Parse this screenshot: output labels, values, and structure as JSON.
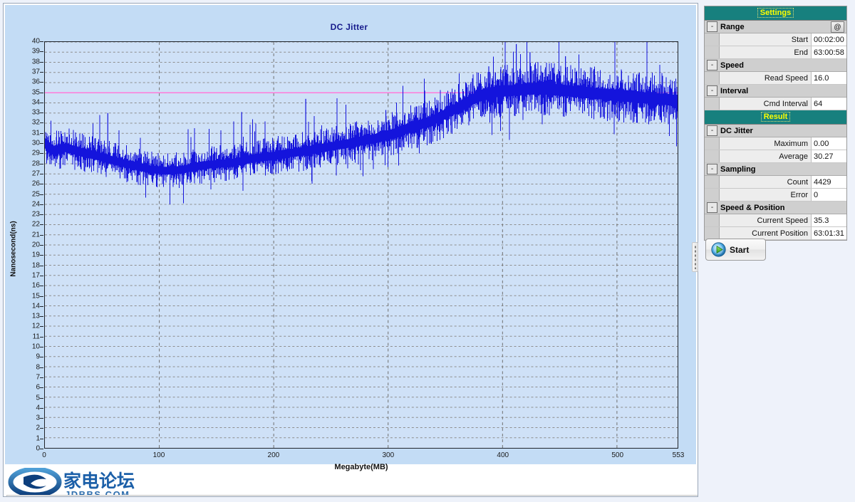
{
  "chart_panel": {
    "title": "DC Jitter",
    "xtitle": "Megabyte(MB)",
    "ytitle": "Nanosecond(ns)",
    "watermark": {
      "cn": "家电论坛",
      "en": "JDBBS.COM"
    }
  },
  "colors": {
    "series": "#1414dc",
    "reference_line": "#ff7ad9",
    "plot_bg": "#cfe1f7",
    "panel_sky": "#c3dcf5",
    "header_bg": "#17807e",
    "header_text": "#ffff00",
    "title_text": "#161b8c"
  },
  "settings": {
    "header": "Settings",
    "at_button": "@",
    "groups": [
      {
        "name": "Range",
        "collapse": "-",
        "rows": [
          {
            "label": "Start",
            "value": "00:02:00"
          },
          {
            "label": "End",
            "value": "63:00:58"
          }
        ]
      },
      {
        "name": "Speed",
        "collapse": "-",
        "rows": [
          {
            "label": "Read Speed",
            "value": "16.0"
          }
        ]
      },
      {
        "name": "Interval",
        "collapse": "-",
        "rows": [
          {
            "label": "Cmd Interval",
            "value": "64"
          }
        ]
      }
    ]
  },
  "result": {
    "header": "Result",
    "groups": [
      {
        "name": "DC Jitter",
        "collapse": "-",
        "rows": [
          {
            "label": "Maximum",
            "value": "0.00"
          },
          {
            "label": "Average",
            "value": "30.27"
          }
        ]
      },
      {
        "name": "Sampling",
        "collapse": "-",
        "rows": [
          {
            "label": "Count",
            "value": "4429"
          },
          {
            "label": "Error",
            "value": "0"
          }
        ]
      },
      {
        "name": "Speed & Position",
        "collapse": "-",
        "rows": [
          {
            "label": "Current Speed",
            "value": "35.3"
          },
          {
            "label": "Current Position",
            "value": "63:01:31"
          }
        ]
      }
    ]
  },
  "start_button": {
    "label": "Start",
    "icon": "play-icon"
  },
  "chart_data": {
    "type": "line",
    "title": "DC Jitter",
    "xlabel": "Megabyte(MB)",
    "ylabel": "Nanosecond(ns)",
    "xlim": [
      0,
      553
    ],
    "ylim": [
      0,
      40
    ],
    "xticks": [
      0,
      100,
      200,
      300,
      400,
      500,
      553
    ],
    "yticks": [
      0,
      1,
      2,
      3,
      4,
      5,
      6,
      7,
      8,
      9,
      10,
      11,
      12,
      13,
      14,
      15,
      16,
      17,
      18,
      19,
      20,
      21,
      22,
      23,
      24,
      25,
      26,
      27,
      28,
      29,
      30,
      31,
      32,
      33,
      34,
      35,
      36,
      37,
      38,
      39,
      40
    ],
    "grid": true,
    "legend": "none",
    "reference_lines": [
      {
        "y": 35,
        "color": "#ff7ad9"
      }
    ],
    "annotations": {
      "average": 30.27,
      "sample_count": 4429,
      "errors": 0
    },
    "series": [
      {
        "name": "DC Jitter",
        "color": "#1414dc",
        "description": "Dense noisy jitter trace sampled across the disc; envelope given as min/max band per MB control point.",
        "x": [
          0,
          8,
          18,
          30,
          45,
          60,
          75,
          90,
          105,
          120,
          135,
          150,
          165,
          172,
          180,
          195,
          210,
          225,
          240,
          255,
          270,
          285,
          300,
          310,
          320,
          335,
          345,
          355,
          365,
          375,
          385,
          395,
          405,
          415,
          425,
          435,
          445,
          455,
          465,
          475,
          485,
          495,
          505,
          515,
          525,
          535,
          545,
          553
        ],
        "center": [
          30.0,
          29.3,
          29.6,
          29.2,
          28.8,
          28.3,
          27.9,
          27.5,
          27.3,
          27.4,
          27.8,
          28.0,
          28.1,
          28.3,
          28.5,
          28.7,
          29.0,
          29.2,
          29.5,
          29.8,
          30.1,
          30.4,
          30.8,
          31.2,
          31.6,
          32.1,
          32.6,
          33.2,
          33.8,
          34.4,
          34.9,
          35.1,
          35.2,
          35.3,
          35.4,
          35.4,
          35.3,
          35.2,
          35.1,
          35.0,
          34.9,
          34.8,
          34.7,
          34.6,
          34.5,
          34.4,
          34.3,
          34.2
        ],
        "min": [
          28.6,
          27.8,
          28.0,
          27.6,
          27.2,
          26.7,
          26.3,
          26.0,
          25.9,
          26.0,
          26.4,
          26.6,
          26.7,
          27.0,
          27.1,
          27.3,
          27.5,
          27.7,
          28.0,
          28.3,
          28.6,
          28.9,
          29.2,
          29.6,
          30.0,
          30.4,
          30.9,
          31.4,
          32.0,
          32.5,
          32.9,
          33.1,
          33.2,
          33.3,
          33.3,
          33.3,
          33.2,
          33.1,
          33.0,
          32.9,
          32.8,
          32.6,
          32.5,
          32.4,
          32.3,
          32.2,
          32.1,
          32.0
        ],
        "max": [
          31.8,
          31.2,
          31.4,
          30.9,
          30.4,
          29.8,
          29.3,
          29.0,
          28.8,
          29.0,
          29.4,
          29.6,
          29.8,
          30.0,
          30.2,
          30.4,
          30.7,
          31.0,
          31.3,
          31.6,
          32.0,
          32.4,
          32.8,
          33.2,
          33.7,
          34.2,
          34.8,
          35.4,
          36.0,
          36.6,
          37.1,
          37.4,
          37.5,
          37.6,
          37.7,
          37.7,
          37.6,
          37.5,
          37.4,
          37.3,
          37.2,
          37.0,
          36.9,
          36.8,
          36.7,
          36.6,
          36.5,
          36.4
        ],
        "spikes": [
          {
            "x": 55,
            "y": 33.0
          },
          {
            "x": 172,
            "y": 33.1
          },
          {
            "x": 228,
            "y": 34.4
          },
          {
            "x": 298,
            "y": 33.3
          },
          {
            "x": 332,
            "y": 35.2
          },
          {
            "x": 388,
            "y": 37.6
          },
          {
            "x": 412,
            "y": 39.8
          },
          {
            "x": 424,
            "y": 39.0
          },
          {
            "x": 455,
            "y": 38.6
          }
        ]
      }
    ]
  }
}
